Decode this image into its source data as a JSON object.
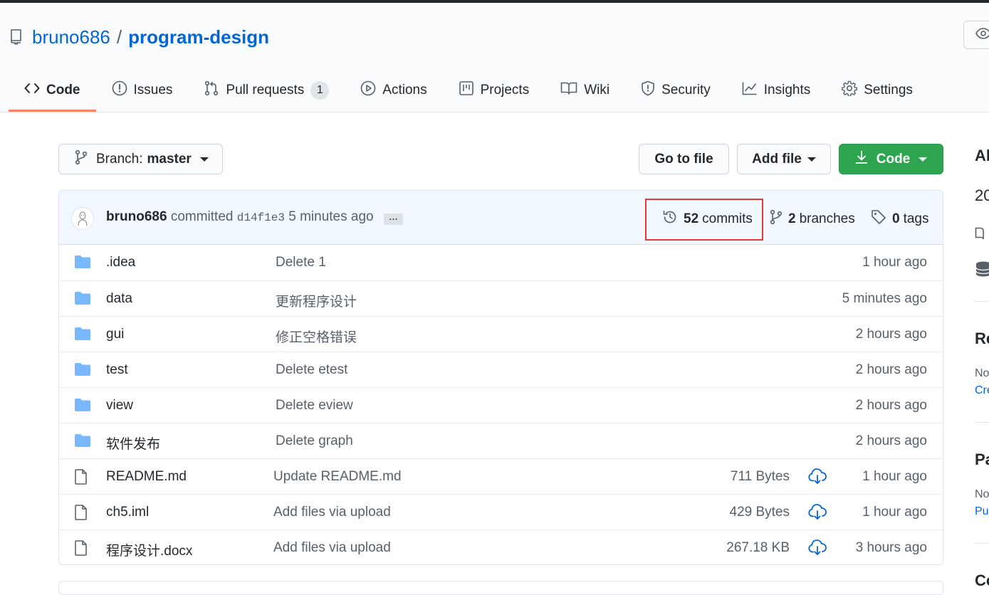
{
  "repo": {
    "owner": "bruno686",
    "separator": "/",
    "name": "program-design"
  },
  "tabs": [
    {
      "label": "Code",
      "icon": "code-icon",
      "active": true
    },
    {
      "label": "Issues",
      "icon": "issue-icon"
    },
    {
      "label": "Pull requests",
      "icon": "pull-request-icon",
      "count": "1"
    },
    {
      "label": "Actions",
      "icon": "play-icon"
    },
    {
      "label": "Projects",
      "icon": "project-icon"
    },
    {
      "label": "Wiki",
      "icon": "book-icon"
    },
    {
      "label": "Security",
      "icon": "shield-icon"
    },
    {
      "label": "Insights",
      "icon": "graph-icon"
    },
    {
      "label": "Settings",
      "icon": "gear-icon"
    }
  ],
  "toolbar": {
    "branch_label": "Branch:",
    "branch_value": "master",
    "go_to_file": "Go to file",
    "add_file": "Add file",
    "code": "Code"
  },
  "commit": {
    "author": "bruno686",
    "verb": "committed",
    "sha": "d14f1e3",
    "time": "5 minutes ago",
    "ellipsis": "…"
  },
  "stats": {
    "commits_count": "52",
    "commits_label": "commits",
    "branches_count": "2",
    "branches_label": "branches",
    "tags_count": "0",
    "tags_label": "tags"
  },
  "files": [
    {
      "type": "dir",
      "name": ".idea",
      "message": "Delete 1",
      "age": "1 hour ago"
    },
    {
      "type": "dir",
      "name": "data",
      "message": "更新程序设计",
      "age": "5 minutes ago"
    },
    {
      "type": "dir",
      "name": "gui",
      "message": "修正空格错误",
      "age": "2 hours ago"
    },
    {
      "type": "dir",
      "name": "test",
      "message": "Delete etest",
      "age": "2 hours ago"
    },
    {
      "type": "dir",
      "name": "view",
      "message": "Delete eview",
      "age": "2 hours ago"
    },
    {
      "type": "dir",
      "name": "软件发布",
      "message": "Delete graph",
      "age": "2 hours ago"
    },
    {
      "type": "file",
      "name": "README.md",
      "message": "Update README.md",
      "size": "711 Bytes",
      "age": "1 hour ago"
    },
    {
      "type": "file",
      "name": "ch5.iml",
      "message": "Add files via upload",
      "size": "429 Bytes",
      "age": "1 hour ago"
    },
    {
      "type": "file",
      "name": "程序设计.docx",
      "message": "Add files via upload",
      "size": "267.18 KB",
      "age": "3 hours ago"
    }
  ],
  "sidebar": {
    "about_title": "Ab",
    "about_desc": "20",
    "releases_title": "Re",
    "releases_none": "No",
    "releases_link": "Cre",
    "packages_title": "Pa",
    "packages_none": "No",
    "packages_link": "Pul",
    "contributors_title": "Co"
  },
  "colors": {
    "link": "#0366d6",
    "primary_button": "#2ea44f",
    "active_tab_underline": "#f9826c",
    "commit_bar": "#f1f8ff",
    "highlight_box": "#e53935",
    "folder": "#79b8ff"
  }
}
